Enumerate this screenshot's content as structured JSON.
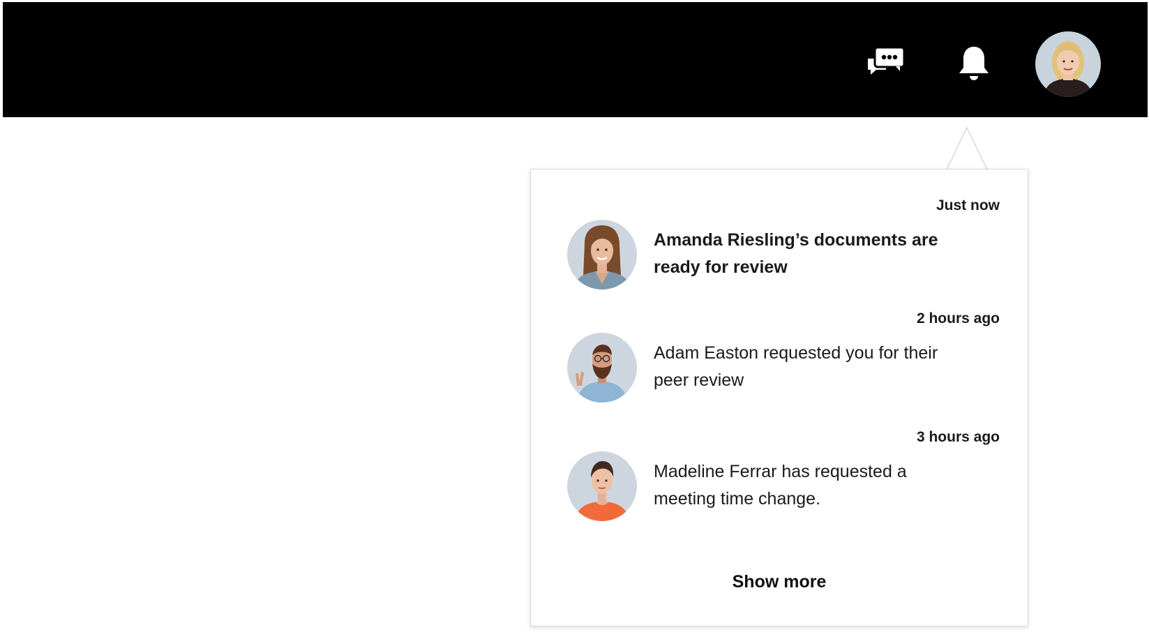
{
  "header": {
    "background": "#000000",
    "icons": {
      "chat": "chat-bubbles-icon",
      "bell": "bell-icon",
      "avatar": "user-avatar"
    }
  },
  "notifications_panel": {
    "items": [
      {
        "time": "Just now",
        "message": "Amanda Riesling’s documents are ready for review",
        "unread": true
      },
      {
        "time": "2 hours ago",
        "message": "Adam Easton requested you for their peer review",
        "unread": false
      },
      {
        "time": "3 hours ago",
        "message": "Madeline Ferrar has requested a meeting time change.",
        "unread": false
      }
    ],
    "show_more_label": "Show more"
  }
}
